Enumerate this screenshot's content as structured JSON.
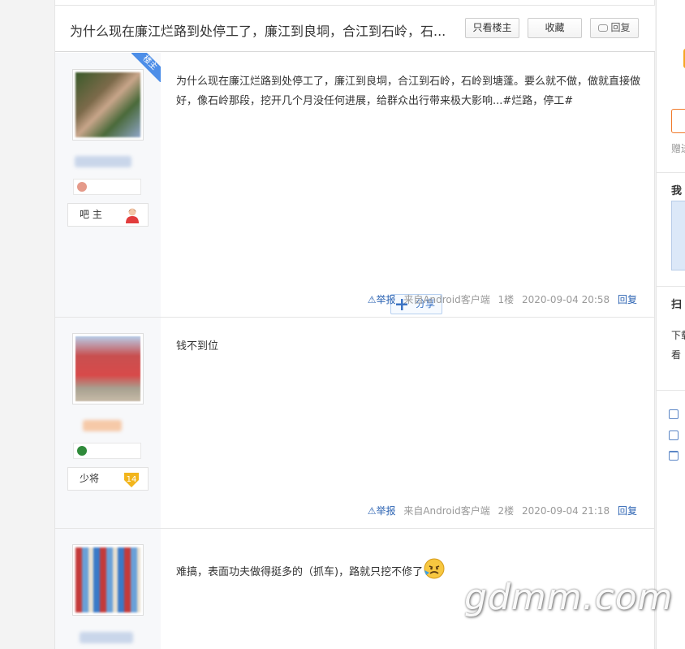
{
  "thread": {
    "title": "为什么现在廉江烂路到处停工了，廉江到良垌，合江到石岭，石...",
    "only_op_label": "只看楼主",
    "favorite_label": "收藏",
    "reply_label": "回复"
  },
  "posts": [
    {
      "corner_badge": "楼主",
      "rank_label": "吧 主",
      "content": "为什么现在廉江烂路到处停工了，廉江到良垌，合江到石岭，石岭到塘蓬。要么就不做，做就直接做好，像石岭那段，挖开几个月没任何进展，给群众出行带来极大影响...#烂路，停工#",
      "share_label": "分享",
      "report_label": "举报",
      "source": "来自Android客户端",
      "floor": "1楼",
      "time": "2020-09-04 20:58",
      "reply_label": "回复"
    },
    {
      "rank_label": "少将",
      "rank_level": "14",
      "content": "钱不到位",
      "report_label": "举报",
      "source": "来自Android客户端",
      "floor": "2楼",
      "time": "2020-09-04 21:18",
      "reply_label": "回复"
    },
    {
      "content": "难搞，表面功夫做得挺多的（抓车)，路就只挖不修了"
    }
  ],
  "sidebar": {
    "text1": "赠送",
    "text2": "我",
    "text3": "扫",
    "text4": "下载",
    "text5": "看"
  },
  "watermark": "gdmm.com",
  "colors": {
    "link": "#2d64b3",
    "badge": "#4d8ee8"
  }
}
